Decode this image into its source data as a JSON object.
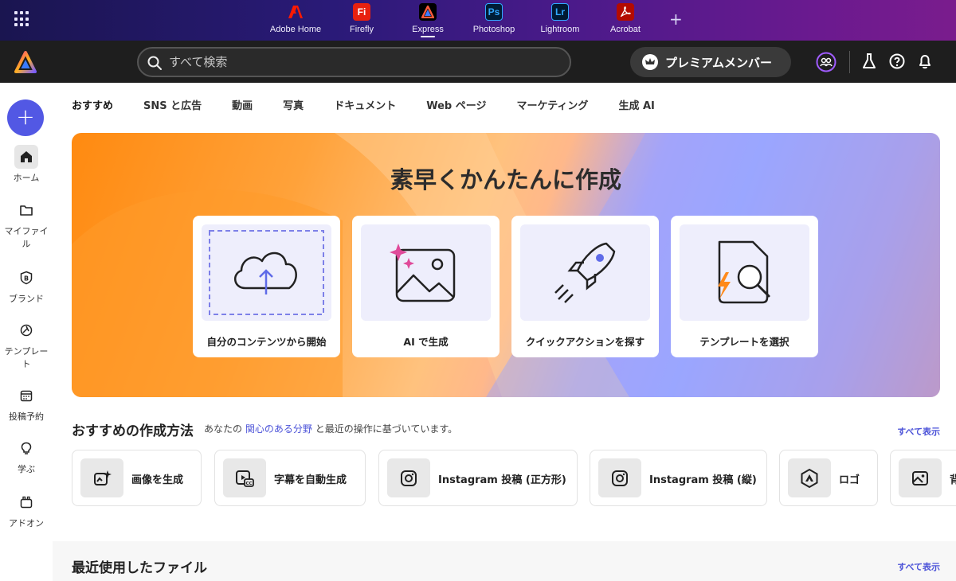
{
  "app_switcher": {
    "apps": [
      {
        "label": "Adobe Home",
        "logo_text": "",
        "color": "#e8210f"
      },
      {
        "label": "Firefly",
        "logo_text": "Fi",
        "color": "#e8210f"
      },
      {
        "label": "Express",
        "logo_text": "",
        "color": "#000000",
        "active": true
      },
      {
        "label": "Photoshop",
        "logo_text": "Ps",
        "color": "#001e36"
      },
      {
        "label": "Lightroom",
        "logo_text": "Lr",
        "color": "#001a33"
      },
      {
        "label": "Acrobat",
        "logo_text": "",
        "color": "#b30b00"
      }
    ]
  },
  "header": {
    "search_placeholder": "すべて検索",
    "premium_label": "プレミアムメンバー"
  },
  "rail": {
    "create_label": "+",
    "items": [
      {
        "label": "ホーム",
        "icon": "home-icon"
      },
      {
        "label": "マイファイル",
        "icon": "folder-icon"
      },
      {
        "label": "ブランド",
        "icon": "brand-icon"
      },
      {
        "label": "テンプレート",
        "icon": "template-icon"
      },
      {
        "label": "投稿予約",
        "icon": "calendar-icon"
      },
      {
        "label": "学ぶ",
        "icon": "lightbulb-icon"
      },
      {
        "label": "アドオン",
        "icon": "addon-icon"
      }
    ]
  },
  "tabs": [
    "おすすめ",
    "SNS と広告",
    "動画",
    "写真",
    "ドキュメント",
    "Web ページ",
    "マーケティング",
    "生成 AI"
  ],
  "hero": {
    "title": "素早くかんたんに作成",
    "cards": [
      {
        "label": "自分のコンテンツから開始"
      },
      {
        "label": "AI で生成"
      },
      {
        "label": "クイックアクションを探す"
      },
      {
        "label": "テンプレートを選択"
      }
    ]
  },
  "recommended": {
    "title": "おすすめの作成方法",
    "subtitle_before": "あなたの",
    "subtitle_link": "関心のある分野",
    "subtitle_after": "と最近の操作に基づいています。",
    "see_all": "すべて表示",
    "chips": [
      {
        "label": "画像を生成",
        "icon": "sparkle-image-icon"
      },
      {
        "label": "字幕を自動生成",
        "icon": "caption-icon"
      },
      {
        "label": "Instagram 投稿 (正方形)",
        "icon": "instagram-icon"
      },
      {
        "label": "Instagram 投稿 (縦)",
        "icon": "instagram-icon"
      },
      {
        "label": "ロゴ",
        "icon": "logo-icon"
      },
      {
        "label": "背",
        "icon": "image-icon"
      }
    ]
  },
  "recent": {
    "title": "最近使用したファイル",
    "see_all": "すべて表示"
  }
}
